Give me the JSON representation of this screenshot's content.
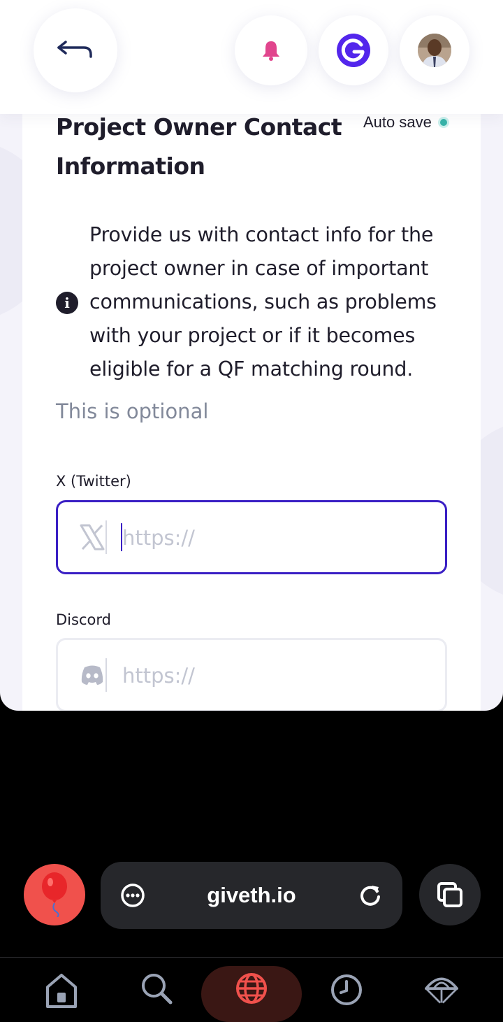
{
  "header": {
    "back_icon": "back-arrow-icon",
    "notifications_icon": "bell-icon",
    "giveth_icon": "giveth-logo-icon",
    "avatar_icon": "user-avatar",
    "colors": {
      "bell": "#e1458d",
      "giveth": "#5326ec",
      "back": "#1f2a5a"
    }
  },
  "section": {
    "title": "Project Owner Contact Information",
    "autosave_label": "Auto save",
    "autosave_color": "#37b4a9",
    "info_icon": "info-icon",
    "info_text": "Provide us with contact info for the project owner in case of important communications, such as problems with your project or if it becomes eligible for a QF matching round.",
    "optional_text": "This is optional"
  },
  "fields": {
    "twitter": {
      "label": "X (Twitter)",
      "placeholder": "https://",
      "value": "",
      "icon": "x-twitter-icon"
    },
    "discord": {
      "label": "Discord",
      "placeholder": "https://",
      "value": "",
      "icon": "discord-icon"
    }
  },
  "browser": {
    "url": "giveth.io",
    "balloon_icon": "balloon-icon",
    "menu_icon": "more-dots-icon",
    "reload_icon": "reload-icon",
    "tabs_icon": "tabs-icon",
    "nav": [
      "home-icon",
      "search-icon",
      "globe-icon",
      "history-icon",
      "parachute-icon"
    ],
    "accent": "#f0514c"
  }
}
